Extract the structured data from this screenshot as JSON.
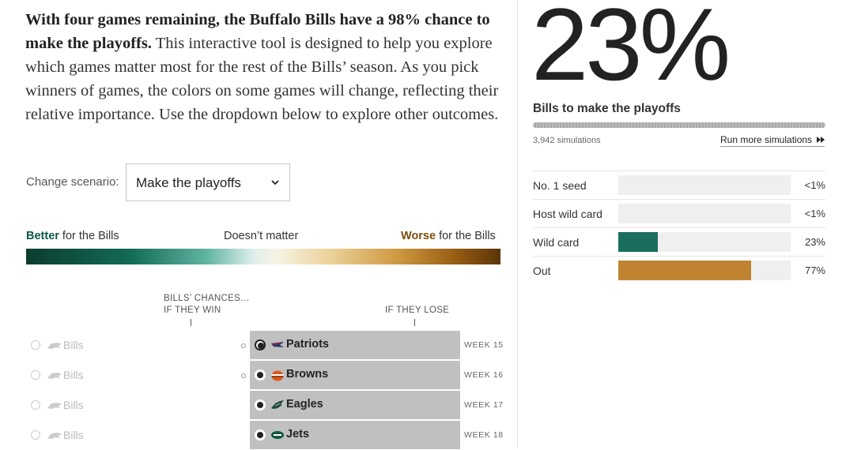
{
  "intro": {
    "bold": "With four games remaining, the Buffalo Bills have a 98% chance to make the playoffs.",
    "rest": " This interactive tool is designed to help you explore which games matter most for the rest of the Bills’ season. As you pick winners of games, the colors on some games will change, reflecting their relative importance. Use the dropdown below to explore other outcomes."
  },
  "scenario": {
    "label": "Change scenario:",
    "selected": "Make the playoffs"
  },
  "legend": {
    "better_bold": "Better",
    "better_rest": " for the Bills",
    "middle": "Doesn’t matter",
    "worse_bold": "Worse",
    "worse_rest": " for the Bills",
    "colors": {
      "better": "#0b3d2e",
      "neutral": "#f7f3e3",
      "worse": "#5a3408"
    }
  },
  "table_headers": {
    "if_win_1": "BILLS’ CHANCES…",
    "if_win_2": "IF THEY WIN",
    "if_lose": "IF THEY LOSE"
  },
  "games": [
    {
      "team": "Bills",
      "opponent": "Patriots",
      "week": "WEEK 15",
      "opp_icon": "patriots-logo-icon",
      "selected": true,
      "mini_mark": true
    },
    {
      "team": "Bills",
      "opponent": "Browns",
      "week": "WEEK 16",
      "opp_icon": "browns-logo-icon",
      "selected": false,
      "mini_mark": true
    },
    {
      "team": "Bills",
      "opponent": "Eagles",
      "week": "WEEK 17",
      "opp_icon": "eagles-logo-icon",
      "selected": false,
      "mini_mark": false
    },
    {
      "team": "Bills",
      "opponent": "Jets",
      "week": "WEEK 18",
      "opp_icon": "jets-logo-icon",
      "selected": false,
      "mini_mark": false
    }
  ],
  "summary": {
    "big_percent": "23%",
    "subtitle": "Bills to make the playoffs",
    "simulations": "3,942 simulations",
    "run_more": "Run more simulations",
    "progress": 1.0
  },
  "outcomes": [
    {
      "label": "No. 1 seed",
      "value": "<1%",
      "fraction": 0.0,
      "color": "#1a6e5e"
    },
    {
      "label": "Host wild card",
      "value": "<1%",
      "fraction": 0.0,
      "color": "#1a6e5e"
    },
    {
      "label": "Wild card",
      "value": "23%",
      "fraction": 0.23,
      "color": "#1a6e5e"
    },
    {
      "label": "Out",
      "value": "77%",
      "fraction": 0.77,
      "color": "#c08332"
    }
  ]
}
